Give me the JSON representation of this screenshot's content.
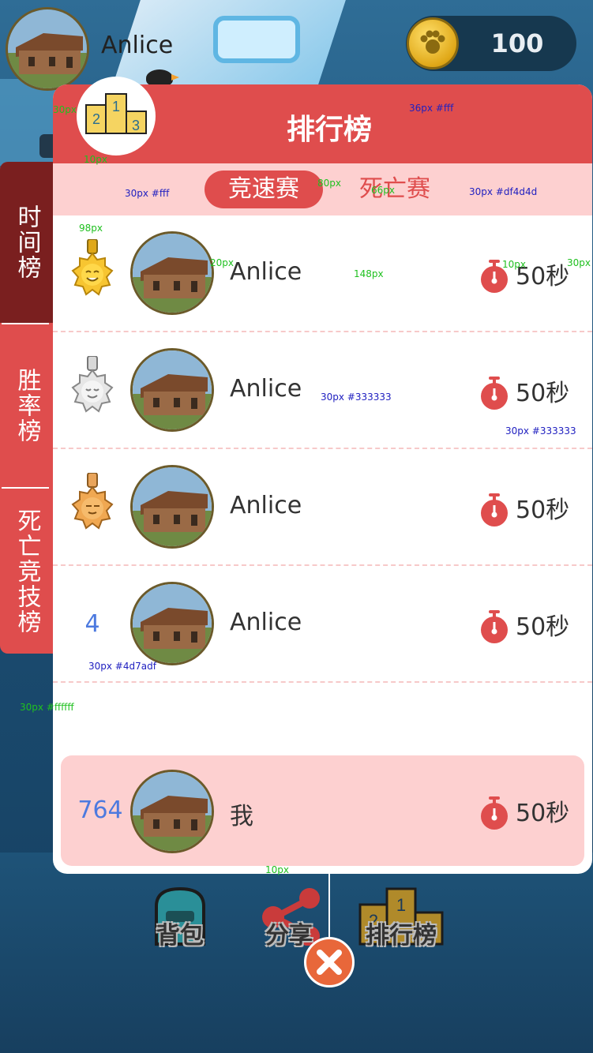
{
  "header": {
    "username": "Anlice",
    "coins": "100"
  },
  "panel": {
    "title": "排行榜",
    "subtabs": [
      {
        "label": "竞速赛",
        "active": true
      },
      {
        "label": "死亡赛",
        "active": false
      }
    ]
  },
  "side_tabs": [
    {
      "label": "时间榜",
      "active": true
    },
    {
      "label": "胜率榜",
      "active": false
    },
    {
      "label": "死亡竞技榜",
      "active": false
    }
  ],
  "rows": [
    {
      "rank": "",
      "medal": "gold-medal-icon",
      "name": "Anlice",
      "time": "50秒"
    },
    {
      "rank": "",
      "medal": "silver-medal-icon",
      "name": "Anlice",
      "time": "50秒"
    },
    {
      "rank": "",
      "medal": "bronze-medal-icon",
      "name": "Anlice",
      "time": "50秒"
    },
    {
      "rank": "4",
      "medal": "",
      "name": "Anlice",
      "time": "50秒"
    }
  ],
  "my_row": {
    "rank": "764",
    "name": "我",
    "time": "50秒"
  },
  "bottom_nav": [
    {
      "label": "背包",
      "icon": "backpack-icon"
    },
    {
      "label": "分享",
      "icon": "share-icon"
    },
    {
      "label": "排行榜",
      "icon": "podium-icon"
    }
  ],
  "colors": {
    "accent": "#df4d4d",
    "accent_light": "#fdd0d0",
    "active_side_tab": "#7a1f1f",
    "rank_number": "#4d7adf",
    "text": "#333333"
  },
  "annotations": [
    {
      "text": "30px"
    },
    {
      "text": "10px"
    },
    {
      "text": "36px #fff"
    },
    {
      "text": "30px #fff"
    },
    {
      "text": "80px"
    },
    {
      "text": "66px"
    },
    {
      "text": "30px #df4d4d"
    },
    {
      "text": "98px"
    },
    {
      "text": "20px"
    },
    {
      "text": "148px"
    },
    {
      "text": "10px"
    },
    {
      "text": "30px"
    },
    {
      "text": "30px #333333"
    },
    {
      "text": "30px #333333"
    },
    {
      "text": "30px #4d7adf"
    },
    {
      "text": "30px #ffffff"
    },
    {
      "text": "10px"
    }
  ]
}
